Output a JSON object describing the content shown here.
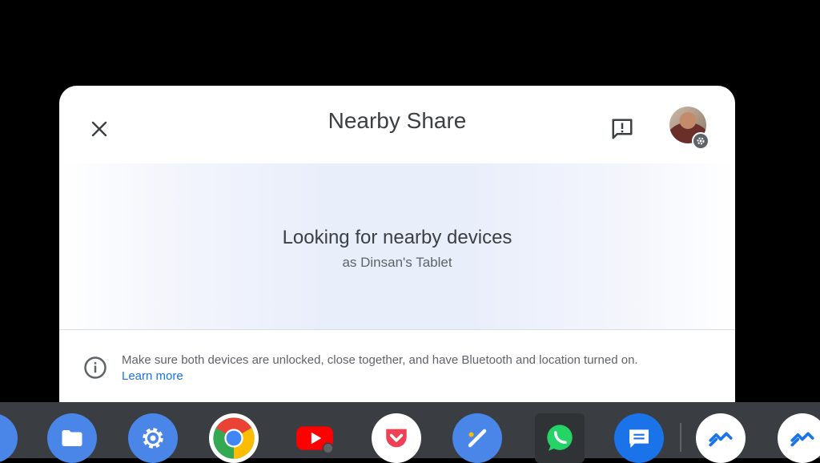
{
  "dialog": {
    "title": "Nearby Share",
    "status_title": "Looking for nearby devices",
    "device_name": "as Dinsan's Tablet",
    "info_text": "Make sure both devices are unlocked, close together, and have Bluetooth and location turned on.",
    "learn_more": "Learn more",
    "icons": {
      "close": "close-icon",
      "feedback": "feedback-icon",
      "avatar_badge": "gear-icon",
      "info": "info-icon"
    }
  },
  "shelf": {
    "apps": [
      {
        "name": "files",
        "color": "#4a86e8"
      },
      {
        "name": "settings",
        "color": "#4a86e8"
      },
      {
        "name": "chrome",
        "color": "#ffffff"
      },
      {
        "name": "youtube",
        "color": "#ff0000"
      },
      {
        "name": "pocket",
        "color": "#ef4056"
      },
      {
        "name": "google-keep-style-app",
        "color": "#4a86e8"
      },
      {
        "name": "whatsapp",
        "color": "#25d366"
      },
      {
        "name": "messages",
        "color": "#1a73e8"
      },
      {
        "name": "nearby-share",
        "color": "#ffffff"
      }
    ]
  },
  "colors": {
    "accent_link": "#1a73e8",
    "text_primary": "#3c4043",
    "text_secondary": "#5f6368",
    "shelf_bg": "#3a3d42"
  }
}
